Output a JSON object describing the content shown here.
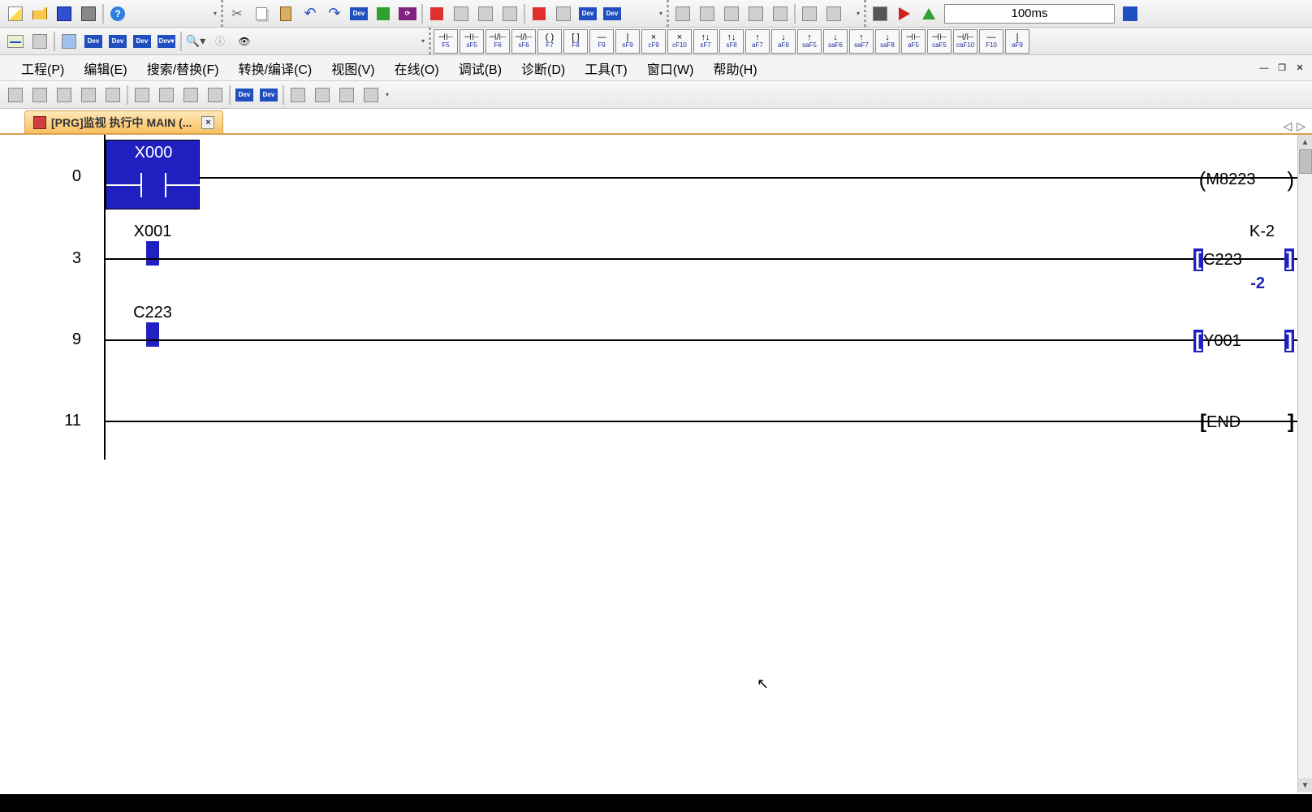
{
  "toolbar1": {
    "new": "new-icon",
    "open": "open-icon",
    "save": "save-icon",
    "print": "print-icon",
    "help": "?",
    "cut": "✂",
    "copy": "copy-icon",
    "paste": "paste-icon",
    "undo": "↶",
    "redo": "↷",
    "dev1": "Dev",
    "dev2": "Dev",
    "dev3": "Dev",
    "time_display": "100ms"
  },
  "fkeys_row2": [
    {
      "sym": "⊣⊢",
      "lbl": "F5"
    },
    {
      "sym": "⊣⊢",
      "lbl": "sF5"
    },
    {
      "sym": "⊣/⊢",
      "lbl": "F6"
    },
    {
      "sym": "⊣/⊢",
      "lbl": "sF6"
    },
    {
      "sym": "( )",
      "lbl": "F7"
    },
    {
      "sym": "[ ]",
      "lbl": "F8"
    },
    {
      "sym": "—",
      "lbl": "F9"
    },
    {
      "sym": "|",
      "lbl": "sF9"
    },
    {
      "sym": "×",
      "lbl": "cF9"
    },
    {
      "sym": "×",
      "lbl": "cF10"
    },
    {
      "sym": "↑↓",
      "lbl": "sF7"
    },
    {
      "sym": "↑↓",
      "lbl": "sF8"
    },
    {
      "sym": "↑",
      "lbl": "aF7"
    },
    {
      "sym": "↓",
      "lbl": "aF8"
    },
    {
      "sym": "↑",
      "lbl": "saF5"
    },
    {
      "sym": "↓",
      "lbl": "saF6"
    },
    {
      "sym": "↑",
      "lbl": "saF7"
    },
    {
      "sym": "↓",
      "lbl": "saF8"
    },
    {
      "sym": "⊣⊢",
      "lbl": "aF5"
    },
    {
      "sym": "⊣⊢",
      "lbl": "caF5"
    },
    {
      "sym": "⊣/⊢",
      "lbl": "caF10"
    },
    {
      "sym": "—",
      "lbl": "F10"
    },
    {
      "sym": "|",
      "lbl": "aF9"
    }
  ],
  "menubar": {
    "items": [
      "工程(P)",
      "编辑(E)",
      "搜索/替换(F)",
      "转换/编译(C)",
      "视图(V)",
      "在线(O)",
      "调试(B)",
      "诊断(D)",
      "工具(T)",
      "窗口(W)",
      "帮助(H)"
    ]
  },
  "tab": {
    "title": "[PRG]监视 执行中 MAIN (...",
    "close": "×"
  },
  "ladder": {
    "rungs": [
      {
        "step": "0",
        "contact": {
          "label": "X000",
          "type": "nopen-selected"
        },
        "output": {
          "type": "coil",
          "label": "M8223"
        }
      },
      {
        "step": "3",
        "contact": {
          "label": "X001",
          "type": "on-block"
        },
        "output": {
          "type": "bracket-hl",
          "label": "C223",
          "above": "K-2",
          "below": "-2"
        }
      },
      {
        "step": "9",
        "contact": {
          "label": "C223",
          "type": "on-block"
        },
        "output": {
          "type": "bracket-hl",
          "label": "Y001"
        }
      },
      {
        "step": "11",
        "output": {
          "type": "bracket",
          "label": "END"
        }
      }
    ]
  }
}
